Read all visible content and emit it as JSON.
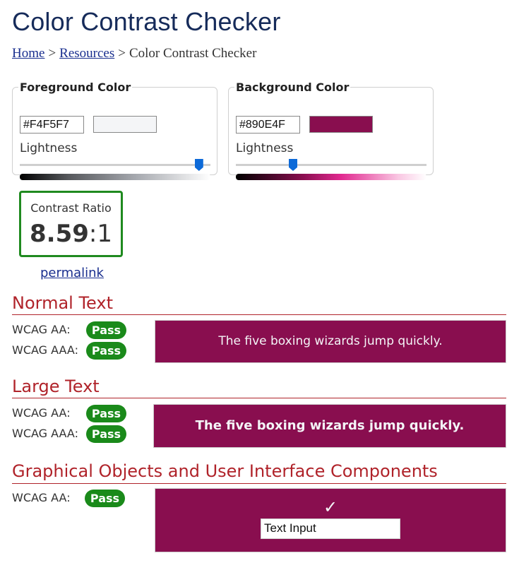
{
  "page": {
    "title": "Color Contrast Checker"
  },
  "breadcrumb": {
    "home": "Home",
    "separator": ">",
    "resources": "Resources",
    "current": "Color Contrast Checker"
  },
  "foreground": {
    "legend": "Foreground Color",
    "hex": "#F4F5F7",
    "swatch_color": "#F4F5F7",
    "lightness_label": "Lightness",
    "lightness_level": 0.94
  },
  "background": {
    "legend": "Background Color",
    "hex": "#890E4F",
    "swatch_color": "#890E4F",
    "lightness_label": "Lightness",
    "lightness_level": 0.3
  },
  "contrast": {
    "label": "Contrast Ratio",
    "value": "8.59",
    "suffix": ":1",
    "border_color": "#1f8a1f"
  },
  "permalink": "permalink",
  "sections": {
    "normal": {
      "title": "Normal Text",
      "aa_label": "WCAG AA:",
      "aa_result": "Pass",
      "aaa_label": "WCAG AAA:",
      "aaa_result": "Pass",
      "sample_text": "The five boxing wizards jump quickly."
    },
    "large": {
      "title": "Large Text",
      "aa_label": "WCAG AA:",
      "aa_result": "Pass",
      "aaa_label": "WCAG AAA:",
      "aaa_result": "Pass",
      "sample_text": "The five boxing wizards jump quickly."
    },
    "graphical": {
      "title": "Graphical Objects and User Interface Components",
      "aa_label": "WCAG AA:",
      "aa_result": "Pass",
      "check_glyph": "✓",
      "input_text": "Text Input"
    }
  },
  "colors": {
    "title": "#162b5a",
    "section_heading": "#b0232a",
    "pass_badge": "#1a8a1a",
    "link": "#1a2f8f"
  }
}
